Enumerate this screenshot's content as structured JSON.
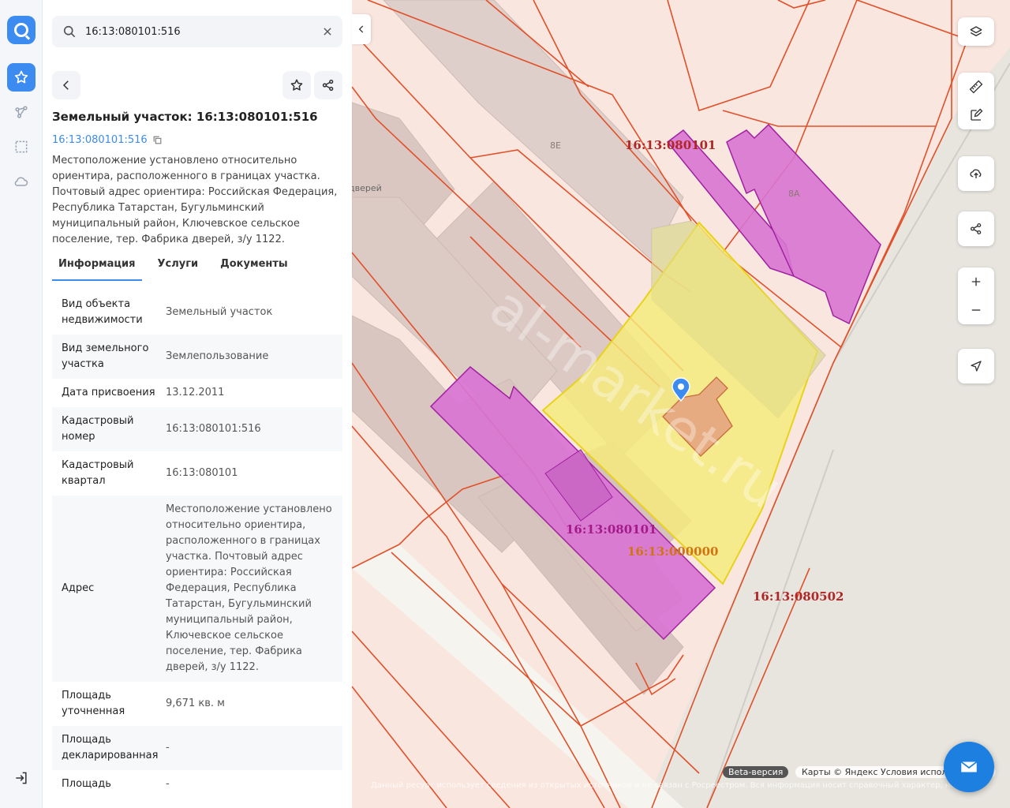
{
  "search": {
    "value": "16:13:080101:516"
  },
  "header": {
    "title": "Земельный участок: 16:13:080101:516",
    "cad_link": "16:13:080101:516",
    "description": "Местоположение установлено относительно ориентира, расположенного в границах участка. Почтовый адрес ориентира: Российская Федерация, Республика Татарстан, Бугульминский муниципальный район, Ключевское сельское поселение, тер. Фабрика дверей, з/у 1122."
  },
  "tabs": [
    "Информация",
    "Услуги",
    "Документы"
  ],
  "info_rows": [
    {
      "key": "Вид объекта недвижимости",
      "value": "Земельный участок"
    },
    {
      "key": "Вид земельного участка",
      "value": "Землепользование"
    },
    {
      "key": "Дата присвоения",
      "value": "13.12.2011"
    },
    {
      "key": "Кадастровый номер",
      "value": "16:13:080101:516"
    },
    {
      "key": "Кадастровый квартал",
      "value": "16:13:080101"
    },
    {
      "key": "Адрес",
      "value": "Местоположение установлено относительно ориентира, расположенного в границах участка. Почтовый адрес ориентира: Российская Федерация, Республика Татарстан, Бугульминский муниципальный район, Ключевское сельское поселение, тер. Фабрика дверей, з/у 1122."
    },
    {
      "key": "Площадь уточненная",
      "value": "9,671 кв. м"
    },
    {
      "key": "Площадь декларированная",
      "value": "-"
    },
    {
      "key": "Площадь",
      "value": "-"
    }
  ],
  "map": {
    "labels": {
      "quarter_top": "16:13:080101",
      "quarter_mid": "16:13:080101",
      "quarter_zero": "16:13:000000",
      "quarter_right": "16:13:080502"
    },
    "buildings": {
      "b8e": "8Е",
      "b8a": "8А",
      "doors": "дверей"
    },
    "watermark": "al-market.ru",
    "beta": "Beta-версия",
    "copyright": "Карты © Яндекс   Условия использования",
    "disclaimer": "Данный ресурс использует сведения из открытых источников и не связан с Росреестром. Вся информация носит справочный характер, не гарантирует точность и не имеет юридической силы. За официальными сведениями обращайтесь в Росреестр."
  },
  "colors": {
    "accent": "#3c8bf0",
    "parcel_border": "#e0502a",
    "selected_fill": "#f5ec7a",
    "magenta": "#d66fd0"
  }
}
